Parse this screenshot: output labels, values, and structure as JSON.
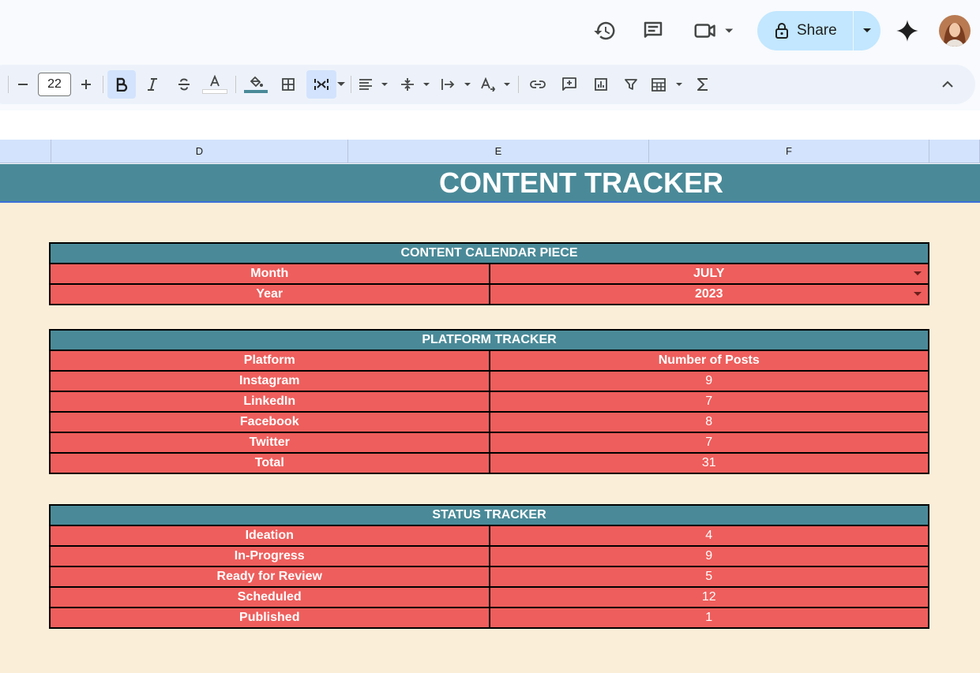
{
  "toolbar": {
    "font_size": "22",
    "fill_color": "#4a8a98",
    "text_color": "#ffffff",
    "icons": [
      "decrease-font-size-icon",
      "increase-font-size-icon",
      "bold-icon",
      "italic-icon",
      "strikethrough-icon",
      "text-color-icon",
      "fill-color-icon",
      "borders-icon",
      "merge-cells-icon",
      "horizontal-align-icon",
      "vertical-align-icon",
      "text-wrapping-icon",
      "text-rotation-icon",
      "insert-link-icon",
      "insert-comment-icon",
      "insert-chart-icon",
      "filter-icon",
      "filter-views-icon",
      "functions-icon",
      "collapse-toolbar-icon"
    ]
  },
  "header": {
    "share_label": "Share",
    "icons": [
      "version-history-icon",
      "comment-icon",
      "meet-icon",
      "gemini-icon",
      "avatar"
    ]
  },
  "columns": [
    "D",
    "E",
    "F"
  ],
  "sheet": {
    "title": "CONTENT TRACKER",
    "colors": {
      "banner": "#4a8a98",
      "row": "#ee5e5c",
      "background": "#fbeed8"
    },
    "calendar": {
      "heading": "CONTENT CALENDAR PIECE",
      "rows": [
        {
          "label": "Month",
          "value": "JULY"
        },
        {
          "label": "Year",
          "value": "2023"
        }
      ]
    },
    "platform": {
      "heading": "PLATFORM TRACKER",
      "col_label": "Platform",
      "col_value": "Number of Posts",
      "rows": [
        {
          "label": "Instagram",
          "value": "9"
        },
        {
          "label": "LinkedIn",
          "value": "7"
        },
        {
          "label": "Facebook",
          "value": "8"
        },
        {
          "label": "Twitter",
          "value": "7"
        },
        {
          "label": "Total",
          "value": "31"
        }
      ]
    },
    "status": {
      "heading": "STATUS TRACKER",
      "rows": [
        {
          "label": "Ideation",
          "value": "4"
        },
        {
          "label": "In-Progress",
          "value": "9"
        },
        {
          "label": "Ready for Review",
          "value": "5"
        },
        {
          "label": "Scheduled",
          "value": "12"
        },
        {
          "label": "Published",
          "value": "1"
        }
      ]
    }
  }
}
